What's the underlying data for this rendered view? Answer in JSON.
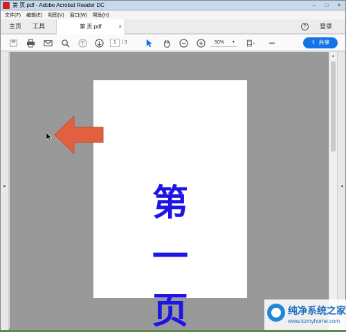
{
  "window": {
    "title": "第 页.pdf - Adobe Acrobat Reader DC",
    "controls": {
      "minimize": "–",
      "maximize": "□",
      "close": "×"
    }
  },
  "menu": [
    "文件(F)",
    "编辑(E)",
    "视图(V)",
    "窗口(W)",
    "帮助(H)"
  ],
  "tabs": {
    "home": "主页",
    "tools": "工具",
    "document": "第 页.pdf",
    "close_glyph": "×",
    "help_glyph": "?",
    "login": "登录"
  },
  "toolbar": {
    "page_current": "1",
    "page_total": "/ 3",
    "zoom": "50%",
    "zoom_dropdown_glyph": "▾",
    "more_glyph": "•••",
    "share_icon": "⇪",
    "share_label": "共享"
  },
  "document": {
    "chars": [
      "第",
      "一",
      "页"
    ],
    "text_color": "#1e14e6"
  },
  "annotation": {
    "arrow_color": "#e2603f",
    "arrow_direction": "left"
  },
  "panes": {
    "left_arrow": "▸",
    "right_arrow": "◂",
    "scroll_up": "▴"
  },
  "watermark": {
    "title": "纯净系统之家",
    "url": "www.kzmyhome.com"
  },
  "colors": {
    "accent": "#1473e6",
    "viewer_bg": "#999999"
  }
}
